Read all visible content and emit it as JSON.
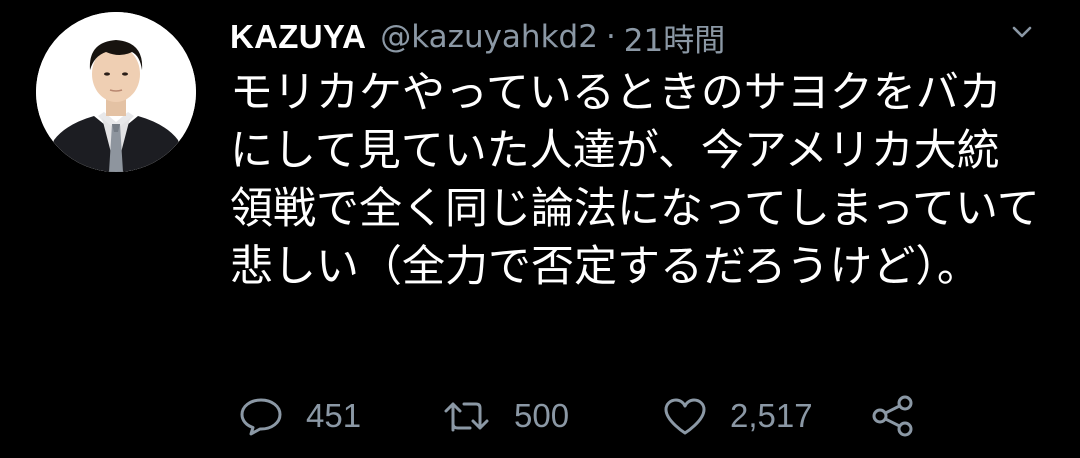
{
  "tweet": {
    "display_name": "KAZUYA",
    "handle": "@kazuyahkd2",
    "separator": "·",
    "time": "21時間",
    "text": "モリカケやっているときのサヨクをバカにして見ていた人達が、今アメリカ大統領戦で全く同じ論法になってしまっていて悲しい（全力で否定するだろうけど）。"
  },
  "actions": {
    "reply_count": "451",
    "retweet_count": "500",
    "like_count": "2,517"
  },
  "icons": {
    "reply": "speech-bubble-icon",
    "retweet": "retweet-arrows-icon",
    "like": "heart-outline-icon",
    "share": "share-nodes-icon",
    "caret": "chevron-down-icon"
  },
  "colors": {
    "background": "#000000",
    "primary_text": "#ffffff",
    "secondary_text": "#8b98a5"
  }
}
